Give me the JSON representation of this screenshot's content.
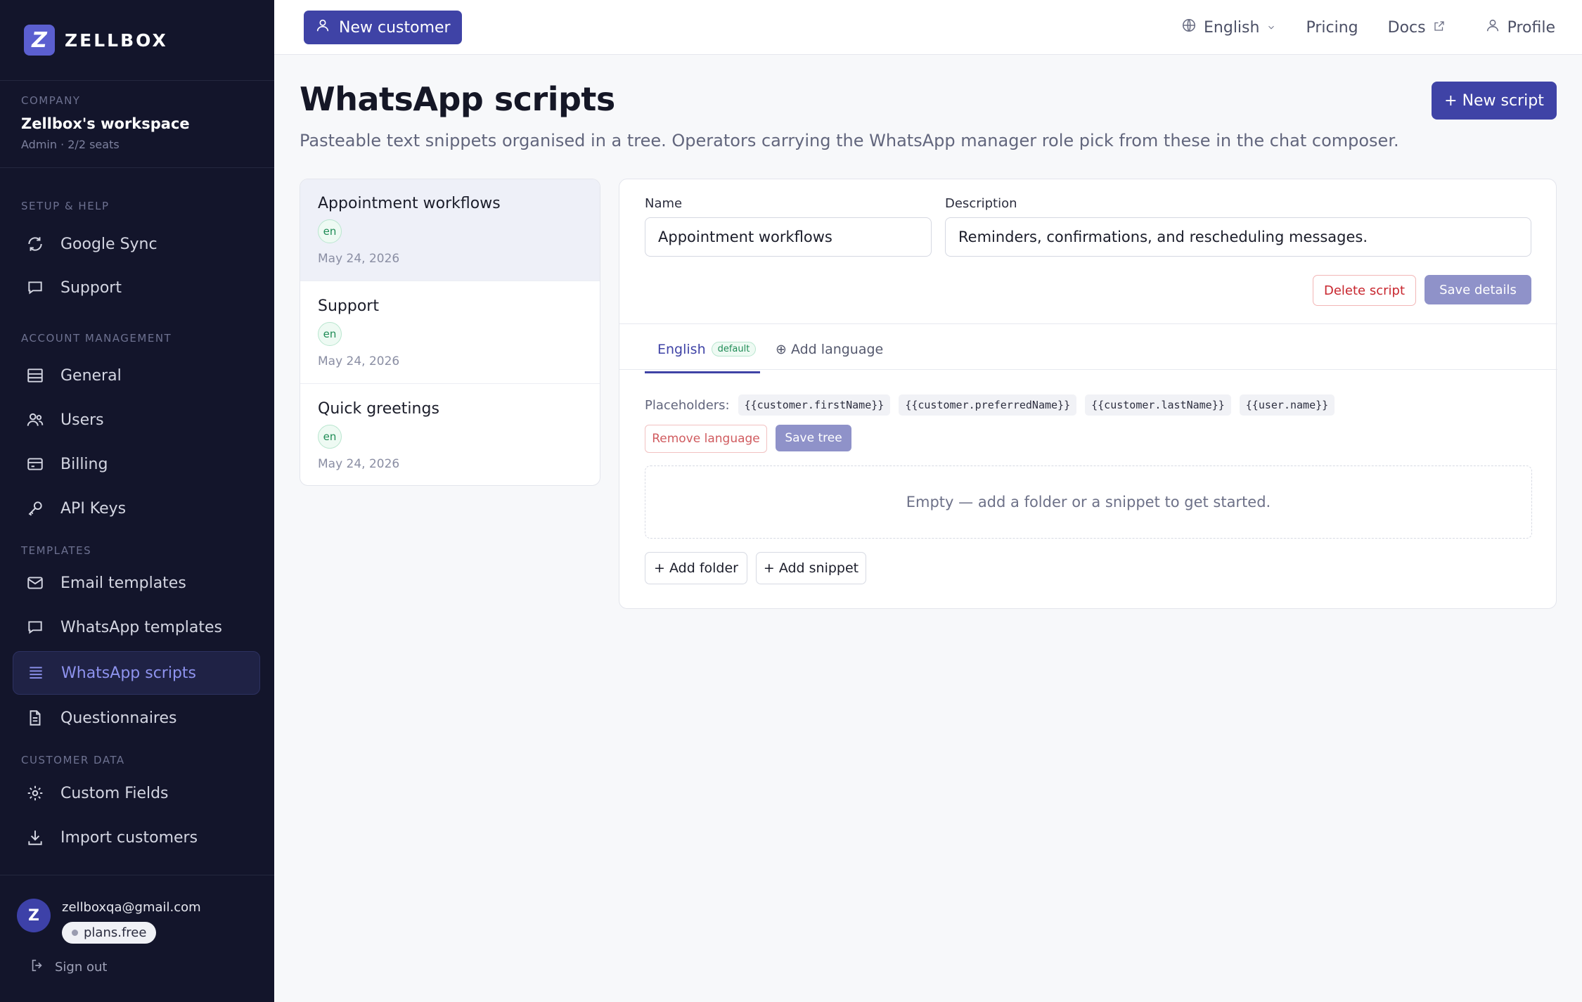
{
  "brand": {
    "logo_letter": "Z",
    "name": "ZELLBOX"
  },
  "company": {
    "label": "Company",
    "name": "Zellbox's workspace",
    "meta": "Admin · 2/2 seats"
  },
  "nav": {
    "sections": [
      "Setup & help",
      "Account management",
      "Templates",
      "Customer data"
    ],
    "items": [
      {
        "label": "Google Sync",
        "icon": "sync-icon"
      },
      {
        "label": "Support",
        "icon": "chat-icon"
      },
      {
        "label": "General",
        "icon": "list-icon"
      },
      {
        "label": "Users",
        "icon": "users-icon"
      },
      {
        "label": "Billing",
        "icon": "card-icon"
      },
      {
        "label": "API Keys",
        "icon": "key-icon"
      },
      {
        "label": "Email templates",
        "icon": "mail-icon"
      },
      {
        "label": "WhatsApp templates",
        "icon": "chat-icon"
      },
      {
        "label": "WhatsApp scripts",
        "icon": "lines-icon"
      },
      {
        "label": "Questionnaires",
        "icon": "doc-icon"
      },
      {
        "label": "Custom Fields",
        "icon": "gear-icon"
      },
      {
        "label": "Import customers",
        "icon": "download-icon"
      }
    ]
  },
  "account": {
    "avatar_letter": "Z",
    "email": "zellboxqa@gmail.com",
    "plan": "plans.free",
    "signout": "Sign out"
  },
  "topbar": {
    "new_customer": "New customer",
    "language": "English",
    "pricing": "Pricing",
    "docs": "Docs",
    "profile": "Profile"
  },
  "page": {
    "title": "WhatsApp scripts",
    "subtitle": "Pasteable text snippets organised in a tree. Operators carrying the WhatsApp manager role pick from these in the chat composer.",
    "new_script": "+ New script"
  },
  "scripts": [
    {
      "title": "Appointment workflows",
      "lang": "en",
      "date": "May 24, 2026"
    },
    {
      "title": "Support",
      "lang": "en",
      "date": "May 24, 2026"
    },
    {
      "title": "Quick greetings",
      "lang": "en",
      "date": "May 24, 2026"
    }
  ],
  "editor": {
    "name_label": "Name",
    "name_value": "Appointment workflows",
    "description_label": "Description",
    "description_value": "Reminders, confirmations, and rescheduling messages.",
    "delete_script": "Delete script",
    "save_details": "Save details",
    "tab_english": "English",
    "tab_default_badge": "default",
    "add_language": "⊕ Add language",
    "placeholders_label": "Placeholders:",
    "placeholders": [
      "{{customer.firstName}}",
      "{{customer.preferredName}}",
      "{{customer.lastName}}",
      "{{user.name}}"
    ],
    "remove_language": "Remove language",
    "save_tree": "Save tree",
    "empty_text": "Empty — add a folder or a snippet to get started.",
    "add_folder": "+ Add folder",
    "add_snippet": "+ Add snippet"
  },
  "colors": {
    "sidebar_bg": "#13152b",
    "accent": "#3f43a6",
    "active_text": "#8e93ee",
    "danger": "#c8262e",
    "success": "#1f8c56"
  }
}
